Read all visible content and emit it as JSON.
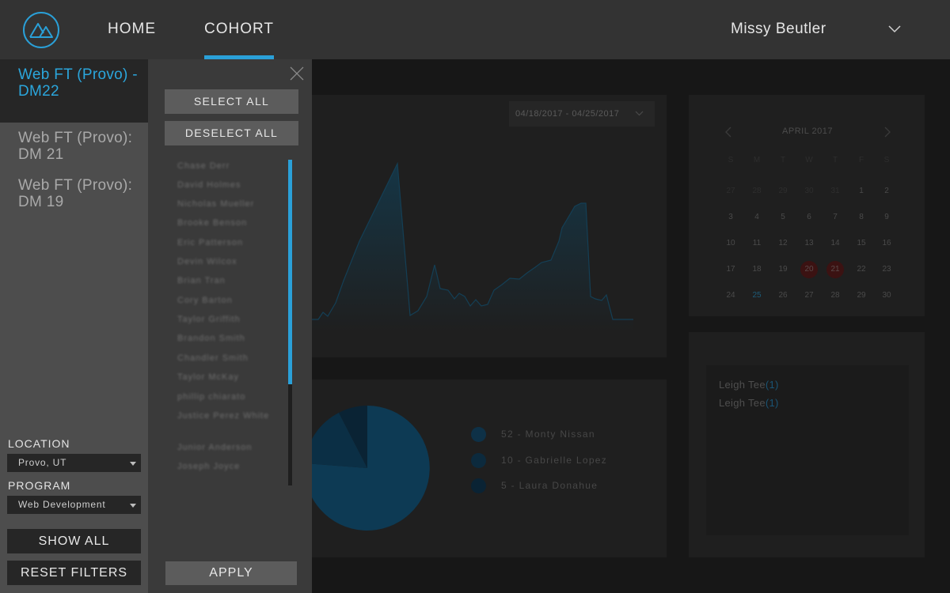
{
  "nav": {
    "home_label": "HOME",
    "cohort_label": "COHORT",
    "user_name": "Missy Beutler",
    "accent_color": "#2aa0d8"
  },
  "sidebar": {
    "cohorts": [
      {
        "label": "Web FT (Provo) - DM22",
        "active": true
      },
      {
        "label": "Web FT (Provo): DM 21",
        "active": false
      },
      {
        "label": "Web FT (Provo): DM 19",
        "active": false
      }
    ],
    "location_label": "LOCATION",
    "location_value": "Provo, UT",
    "program_label": "PROGRAM",
    "program_value": "Web Development",
    "show_all_label": "SHOW ALL",
    "reset_label": "RESET FILTERS"
  },
  "student_panel": {
    "select_all_label": "SELECT ALL",
    "deselect_all_label": "DESELECT ALL",
    "apply_label": "APPLY",
    "students": [
      "Chase Derr",
      "David Holmes",
      "Nicholas Mueller",
      "Brooke Benson",
      "Eric Patterson",
      "Devin Wilcox",
      "Brian Tran",
      "Cory Barton",
      "Taylor Griffith",
      "Brandon Smith",
      "Chandler Smith",
      "Taylor McKay",
      "phillip chiarato",
      "Justice Perez White",
      "Junior Anderson",
      "Joseph Joyce"
    ]
  },
  "dashboard": {
    "date_range": "04/18/2017 - 04/25/2017",
    "calendar": {
      "title": "APRIL 2017",
      "weekday_labels": [
        "S",
        "M",
        "T",
        "W",
        "T",
        "F",
        "S"
      ],
      "weeks": [
        [
          "27",
          "28",
          "29",
          "30",
          "31",
          "1",
          "2"
        ],
        [
          "3",
          "4",
          "5",
          "6",
          "7",
          "8",
          "9"
        ],
        [
          "10",
          "11",
          "12",
          "13",
          "14",
          "15",
          "16"
        ],
        [
          "17",
          "18",
          "19",
          "20",
          "21",
          "22",
          "23"
        ],
        [
          "24",
          "25",
          "26",
          "27",
          "28",
          "29",
          "30"
        ]
      ],
      "marked_days": [
        "20",
        "21"
      ],
      "today": "25"
    },
    "pie_legend": [
      {
        "count": "52",
        "name": "Monty Nissan"
      },
      {
        "count": "10",
        "name": "Gabrielle Lopez"
      },
      {
        "count": "5",
        "name": "Laura Donahue"
      }
    ],
    "leaders": [
      {
        "name": "Leigh Tee",
        "count": "1"
      },
      {
        "name": "Leigh Tee",
        "count": "1"
      }
    ],
    "pie_color": "#0d3a54"
  }
}
